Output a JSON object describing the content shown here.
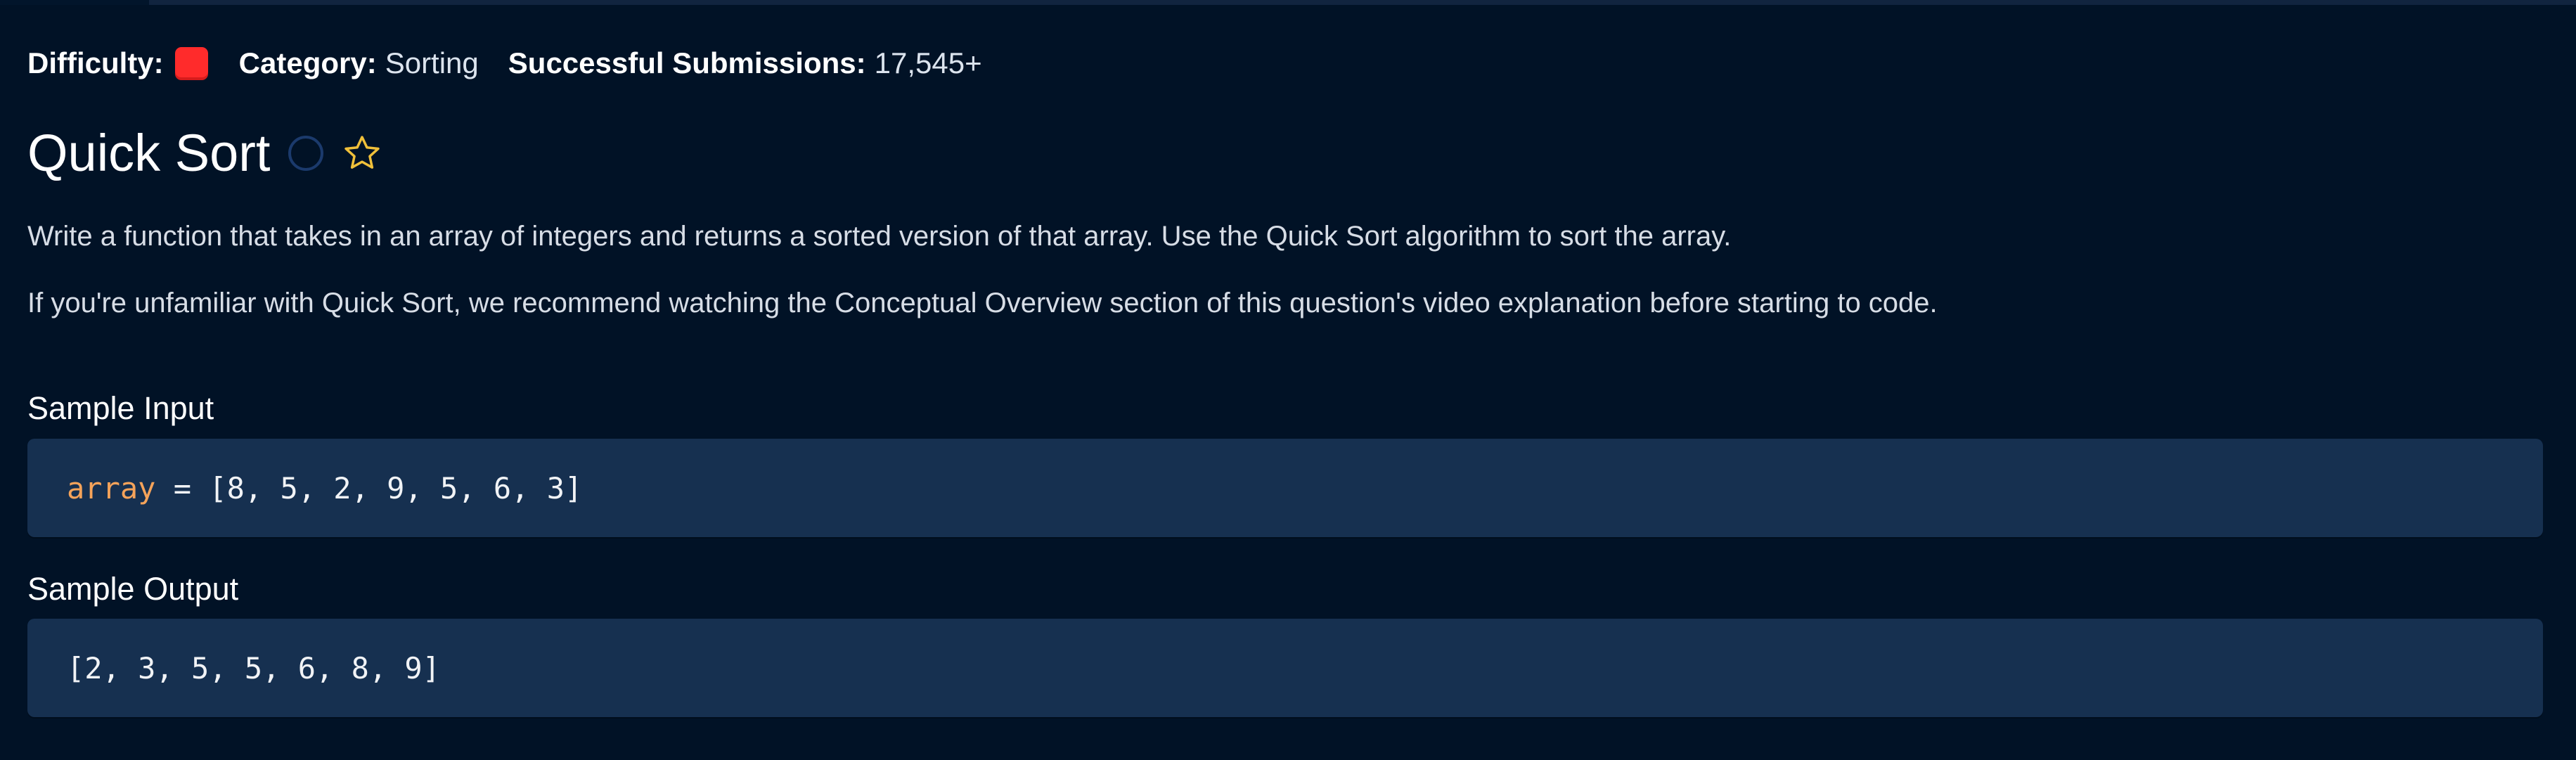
{
  "meta": {
    "difficulty_label": "Difficulty:",
    "difficulty_level": "hard",
    "difficulty_color": "#ff2b2b",
    "category_label": "Category:",
    "category_value": "Sorting",
    "submissions_label": "Successful Submissions:",
    "submissions_value": "17,545+"
  },
  "question": {
    "title": "Quick Sort",
    "status_icon": "incomplete-circle-icon",
    "favorite_icon": "star-outline-icon",
    "favorite_color": "#f0c03a",
    "description": [
      "Write a function that takes in an array of integers and returns a sorted version of that array. Use the Quick Sort algorithm to sort the array.",
      "If you're unfamiliar with Quick Sort, we recommend watching the Conceptual Overview section of this question's video explanation before starting to code."
    ]
  },
  "sample_input": {
    "heading": "Sample Input",
    "variable": "array",
    "operator": " = ",
    "value": "[8, 5, 2, 9, 5, 6, 3]"
  },
  "sample_output": {
    "heading": "Sample Output",
    "value": "[2, 3, 5, 5, 6, 8, 9]"
  },
  "colors": {
    "background": "#011226",
    "code_background": "#163050",
    "code_variable": "#f5a35a"
  }
}
